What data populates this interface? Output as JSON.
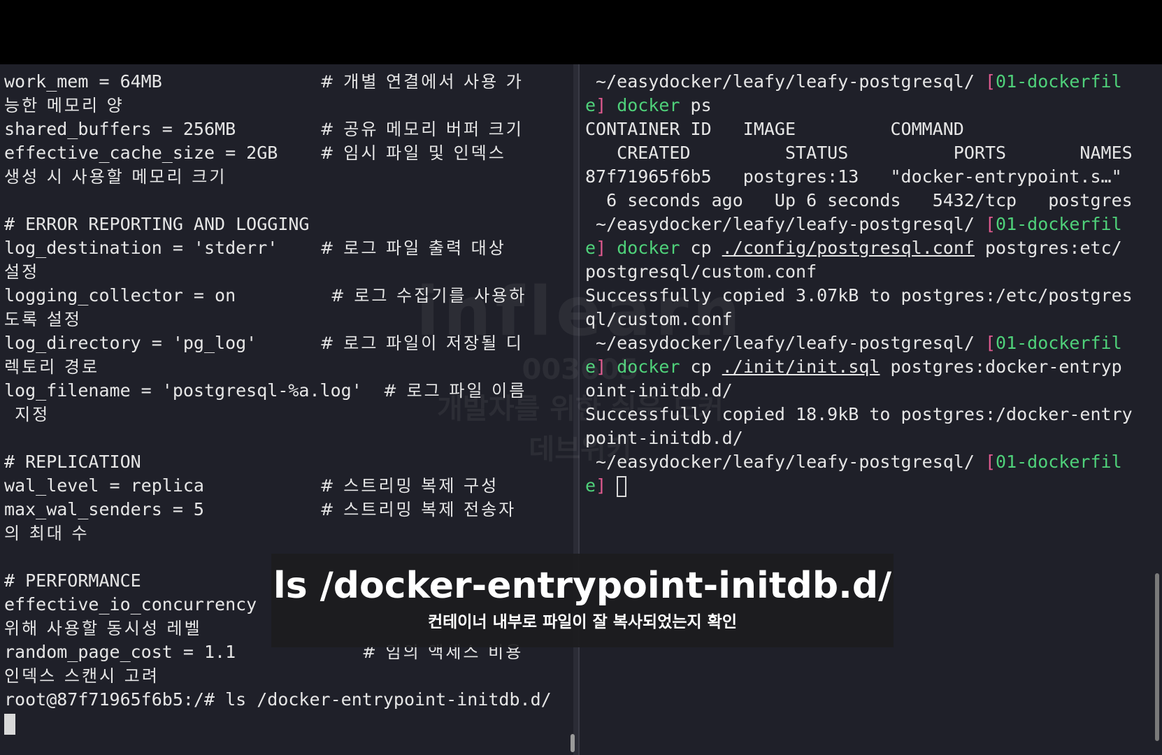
{
  "left_terminal": {
    "lines": [
      {
        "a": "work_mem = 64MB               ",
        "b": "# 개별 연결에서 사용 가"
      },
      {
        "a": "",
        "b": "능한 메모리 양"
      },
      {
        "a": "shared_buffers = 256MB        ",
        "b": "# 공유 메모리 버퍼 크기"
      },
      {
        "a": "effective_cache_size = 2GB    ",
        "b": "# 임시 파일 및 인덱스"
      },
      {
        "a": "",
        "b": "생성 시 사용할 메모리 크기"
      },
      {
        "a": "",
        "b": ""
      },
      {
        "a": "# ERROR REPORTING AND LOGGING",
        "b": ""
      },
      {
        "a": "log_destination = 'stderr'    ",
        "b": "# 로그 파일 출력 대상"
      },
      {
        "a": "",
        "b": "설정"
      },
      {
        "a": "logging_collector = on         ",
        "b": "# 로그 수집기를 사용하"
      },
      {
        "a": "",
        "b": "도록 설정"
      },
      {
        "a": "log_directory = 'pg_log'      ",
        "b": "# 로그 파일이 저장될 디"
      },
      {
        "a": "",
        "b": "렉토리 경로"
      },
      {
        "a": "log_filename = 'postgresql-%a.log'  ",
        "b": "# 로그 파일 이름"
      },
      {
        "a": " ",
        "b": "지정"
      },
      {
        "a": "",
        "b": ""
      },
      {
        "a": "# REPLICATION",
        "b": ""
      },
      {
        "a": "wal_level = replica           ",
        "b": "# 스트리밍 복제 구성"
      },
      {
        "a": "max_wal_senders = 5           ",
        "b": "# 스트리밍 복제 전송자"
      },
      {
        "a": "",
        "b": "의 최대 수"
      },
      {
        "a": "",
        "b": ""
      },
      {
        "a": "# PERFORMANCE",
        "b": ""
      },
      {
        "a": "effective_io_concurrency",
        "b": ""
      },
      {
        "a": "",
        "b": "위해 사용할 동시성 레벨"
      },
      {
        "a": "random_page_cost = 1.1            ",
        "b": "# 임의 액세스 비용"
      },
      {
        "a": "",
        "b": "인덱스 스캔시 고려"
      },
      {
        "a": "root@87f71965f6b5:/# ls /docker-entrypoint-initdb.d/",
        "b": ""
      }
    ]
  },
  "right_terminal": {
    "prompt_path": " ~/easydocker/leafy/leafy-postgresql/ ",
    "branch_open": "[",
    "branch_name_1": "01-dockerfil",
    "branch_name_2": "e",
    "branch_close": "]",
    "apple_glyph": "",
    "cmd_docker": "docker",
    "cmd1_rest": " ps",
    "ps_header_1": "CONTAINER ID   IMAGE         COMMAND",
    "ps_header_2": "   CREATED         STATUS          PORTS       NAMES",
    "ps_row_1": "87f71965f6b5   postgres:13   \"docker-entrypoint.s…\"",
    "ps_row_2": "  6 seconds ago   Up 6 seconds   5432/tcp   postgres",
    "cmd2_cp": " cp ",
    "cmd2_src": "./config/postgresql.conf",
    "cmd2_dst": " postgres:etc/",
    "cmd2_cont": "postgresql/custom.conf",
    "out2_1": "Successfully copied 3.07kB to postgres:/etc/postgres",
    "out2_2": "ql/custom.conf",
    "cmd3_src": "./init/init.sql",
    "cmd3_dst": " postgres:docker-entryp",
    "cmd3_cont": "oint-initdb.d/",
    "out3_1": "Successfully copied 18.9kB to postgres:/docker-entry",
    "out3_2": "point-initdb.d/"
  },
  "watermark": {
    "logo": "inflearn",
    "code": "003605",
    "course": "개발자를 위한 쉬운 도커",
    "author": "데브위키"
  },
  "caption": {
    "command": "ls /docker-entrypoint-initdb.d/",
    "subtitle": "컨테이너 내부로 파일이 잘 복사되었는지 확인"
  }
}
